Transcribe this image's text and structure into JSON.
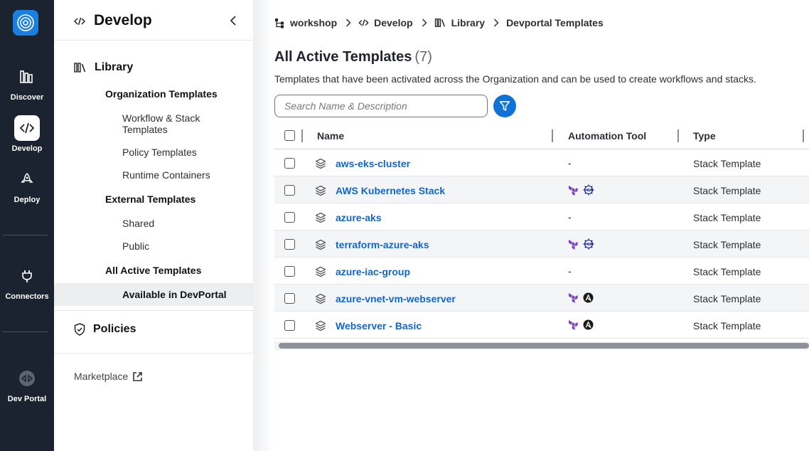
{
  "rail": {
    "items": [
      {
        "label": "Discover",
        "icon": "library-icon"
      },
      {
        "label": "Develop",
        "icon": "code-icon",
        "active": true
      },
      {
        "label": "Deploy",
        "icon": "rocket-icon"
      },
      {
        "label": "Connectors",
        "icon": "plug-icon"
      },
      {
        "label": "Dev Portal",
        "icon": "portal-icon"
      }
    ]
  },
  "sidebar": {
    "title": "Develop",
    "library": "Library",
    "org_templates": "Organization Templates",
    "workflow_stack": "Workflow & Stack Templates",
    "policy_templates": "Policy Templates",
    "runtime_containers": "Runtime Containers",
    "external_templates": "External Templates",
    "shared": "Shared",
    "public": "Public",
    "all_active": "All Active Templates",
    "available_devportal": "Available in DevPortal",
    "policies": "Policies",
    "marketplace": "Marketplace"
  },
  "breadcrumb": {
    "workshop": "workshop",
    "develop": "Develop",
    "library": "Library",
    "current": "Devportal Templates"
  },
  "page": {
    "title": "All Active Templates",
    "count": "(7)",
    "description": "Templates that have been activated across the Organization and can be used to create workflows and stacks.",
    "search_placeholder": "Search Name & Description"
  },
  "table": {
    "headers": {
      "name": "Name",
      "tool": "Automation Tool",
      "type": "Type"
    },
    "rows": [
      {
        "name": "aws-eks-cluster",
        "tool": "-",
        "type": "Stack Template"
      },
      {
        "name": "AWS Kubernetes Stack",
        "tool": "terraform+helm",
        "type": "Stack Template"
      },
      {
        "name": "azure-aks",
        "tool": "-",
        "type": "Stack Template"
      },
      {
        "name": "terraform-azure-aks",
        "tool": "terraform+helm",
        "type": "Stack Template"
      },
      {
        "name": "azure-iac-group",
        "tool": "-",
        "type": "Stack Template"
      },
      {
        "name": "azure-vnet-vm-webserver",
        "tool": "terraform+ansible",
        "type": "Stack Template"
      },
      {
        "name": "Webserver - Basic",
        "tool": "terraform+ansible",
        "type": "Stack Template"
      }
    ]
  },
  "colors": {
    "rail_bg": "#1b2330",
    "accent": "#1172d6",
    "link": "#1366c8",
    "terraform": "#7b42bc",
    "helm": "#0f1689"
  }
}
